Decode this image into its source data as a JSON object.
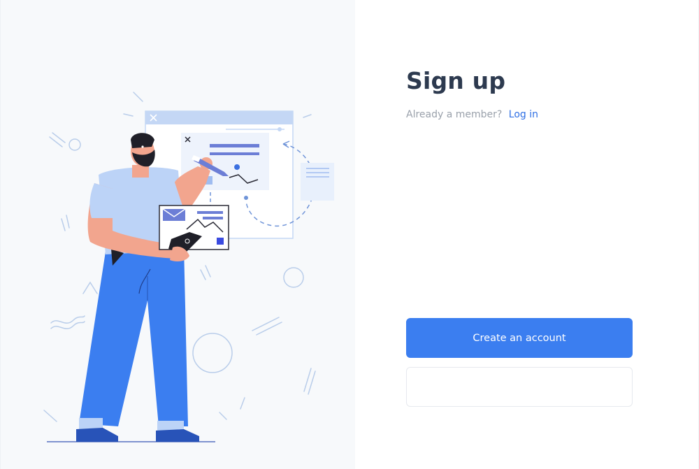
{
  "signup": {
    "title": "Sign up",
    "member_prompt": "Already a member?",
    "login_label": "Log in",
    "create_account_label": "Create an account",
    "secondary_label": ""
  },
  "colors": {
    "primary": "#3b7ef0",
    "link": "#2f6fe4",
    "title": "#2d3a4f",
    "muted": "#9aa1ab",
    "illustration_bg": "#f7f9fb"
  },
  "illustration": {
    "icons": [
      "person-with-phone-illustration",
      "browser-window-icon",
      "map-pin-icon",
      "envelope-icon",
      "close-icon"
    ]
  }
}
